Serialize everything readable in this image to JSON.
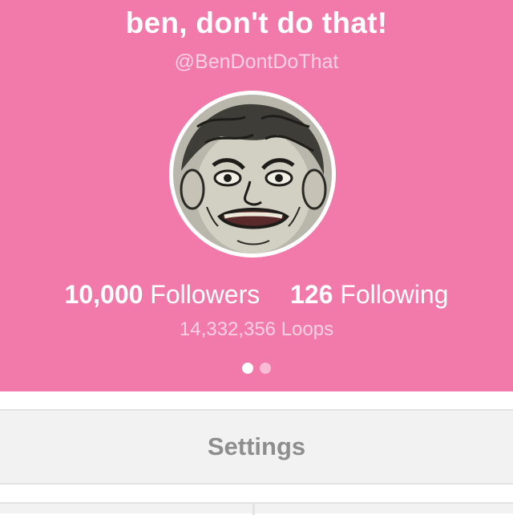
{
  "profile": {
    "display_name": "ben, don't do that!",
    "username": "@BenDontDoThat",
    "avatar_icon": "avatar-illustration",
    "followers_count": "10,000",
    "followers_label": "Followers",
    "following_count": "126",
    "following_label": "Following",
    "loops_count": "14,332,356",
    "loops_label": "Loops",
    "pager": {
      "pages": 2,
      "active_index": 0
    }
  },
  "actions": {
    "settings_label": "Settings"
  },
  "colors": {
    "header_bg": "#f17aab",
    "subtle_text": "#fbd2e3",
    "settings_text": "#8e8e8e",
    "row_bg": "#f2f2f2"
  }
}
